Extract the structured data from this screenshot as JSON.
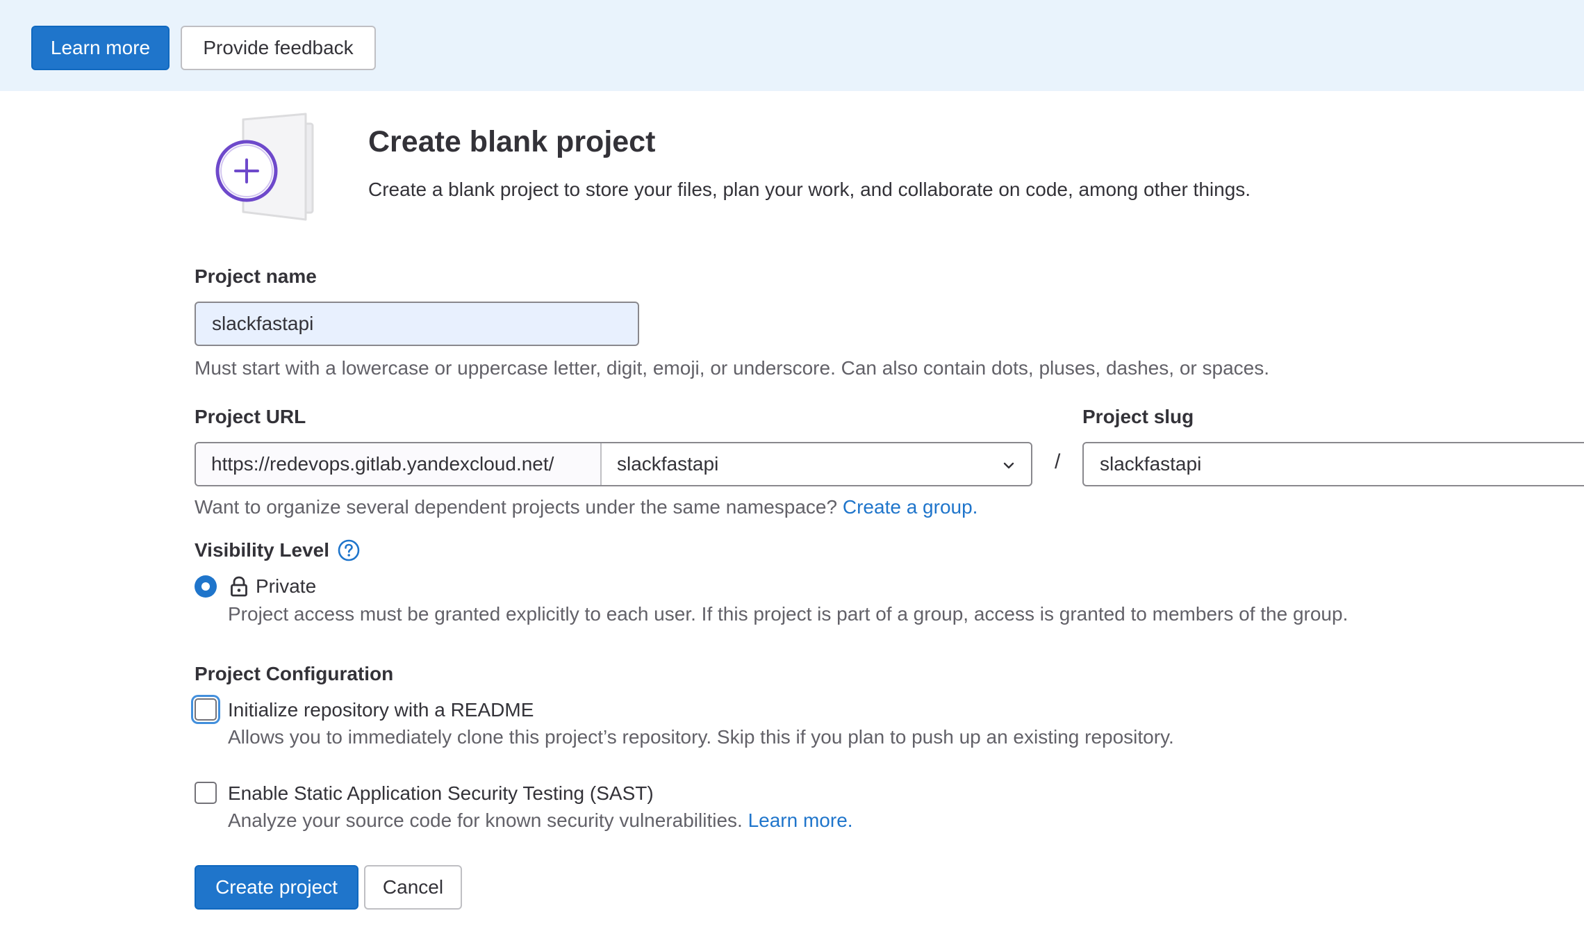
{
  "banner": {
    "learn_more_label": "Learn more",
    "feedback_label": "Provide feedback"
  },
  "header": {
    "title": "Create blank project",
    "subtitle": "Create a blank project to store your files, plan your work, and collaborate on code, among other things."
  },
  "form": {
    "project_name": {
      "label": "Project name",
      "value": "slackfastapi",
      "help": "Must start with a lowercase or uppercase letter, digit, emoji, or underscore. Can also contain dots, pluses, dashes, or spaces."
    },
    "project_url": {
      "label": "Project URL",
      "prefix": "https://redevops.gitlab.yandexcloud.net/",
      "namespace": "slackfastapi",
      "separator": "/",
      "help": "Want to organize several dependent projects under the same namespace?",
      "help_link": "Create a group."
    },
    "project_slug": {
      "label": "Project slug",
      "value": "slackfastapi"
    },
    "visibility": {
      "label": "Visibility Level",
      "option_label": "Private",
      "option_help": "Project access must be granted explicitly to each user. If this project is part of a group, access is granted to members of the group.",
      "selected": true
    },
    "configuration": {
      "label": "Project Configuration",
      "readme": {
        "label": "Initialize repository with a README",
        "help": "Allows you to immediately clone this project’s repository. Skip this if you plan to push up an existing repository.",
        "checked": false
      },
      "sast": {
        "label": "Enable Static Application Security Testing (SAST)",
        "help": "Analyze your source code for known security vulnerabilities.",
        "help_link": "Learn more.",
        "checked": false
      }
    },
    "actions": {
      "create_label": "Create project",
      "cancel_label": "Cancel"
    }
  },
  "colors": {
    "primary": "#1f75cb",
    "banner_bg": "#e9f3fc",
    "illustration_accent": "#6e49cb"
  },
  "icons": [
    "plus-icon",
    "chevron-down-icon",
    "question-circle-icon",
    "lock-icon"
  ]
}
